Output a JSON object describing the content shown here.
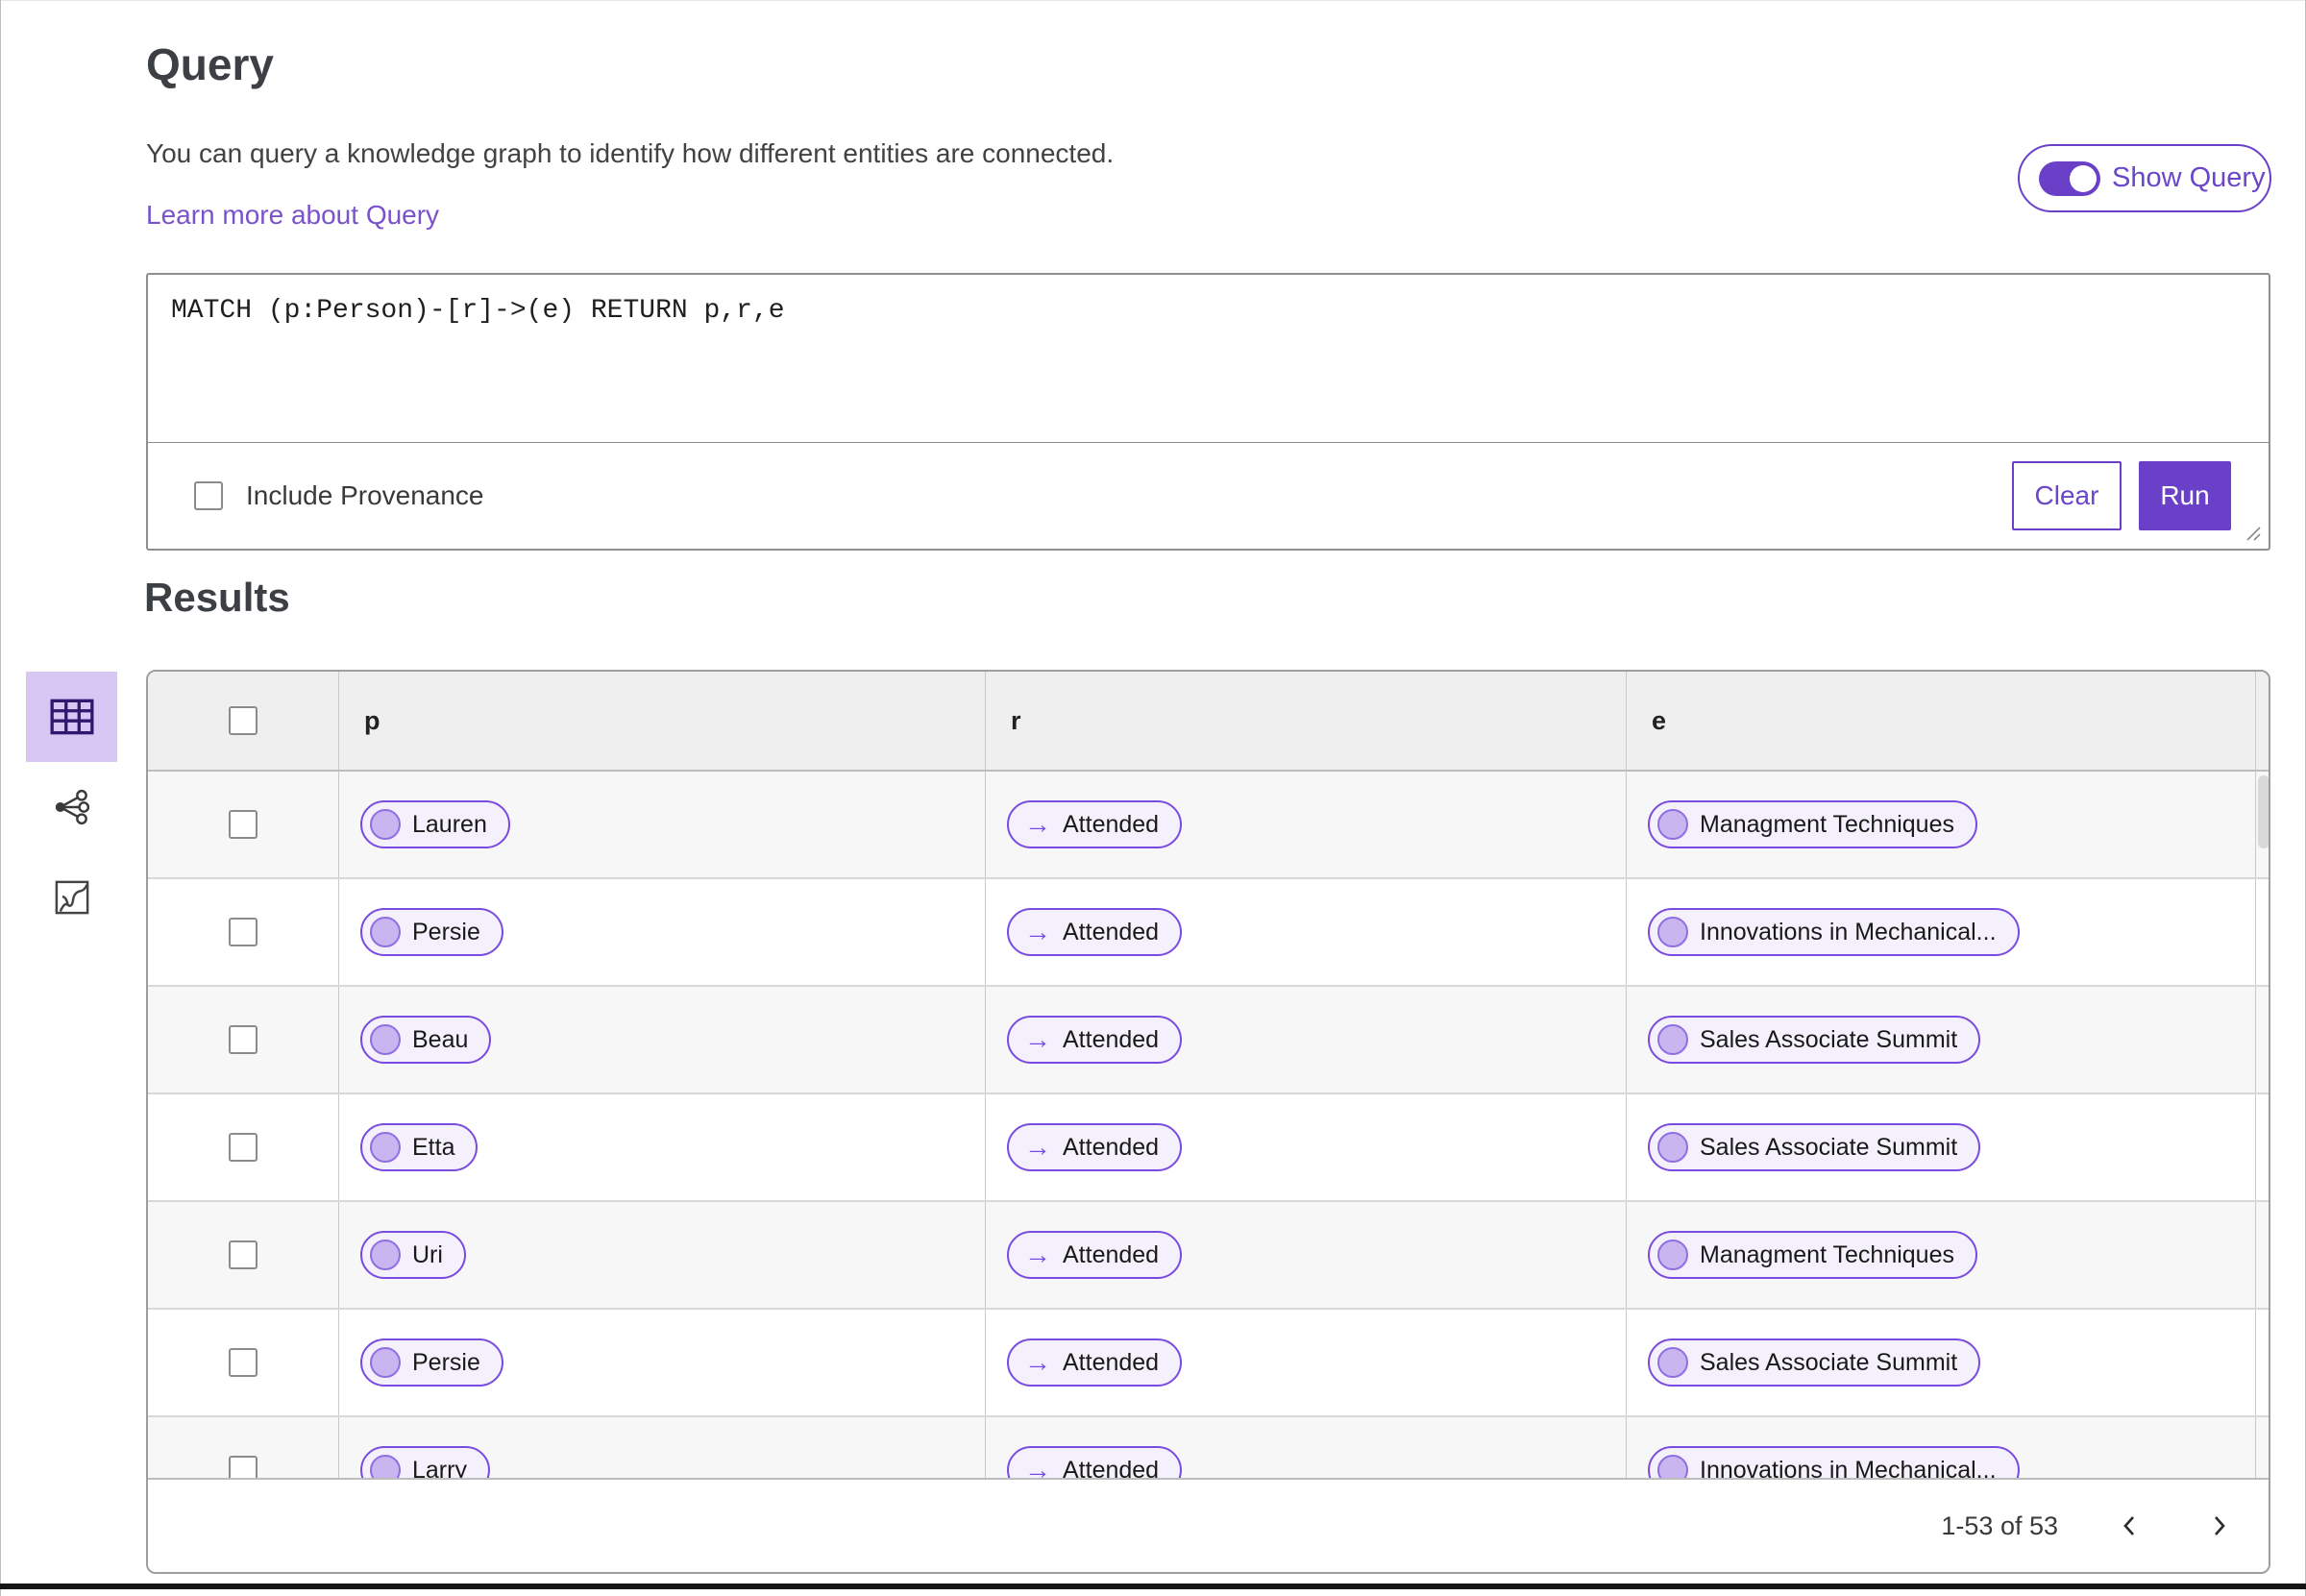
{
  "header": {
    "title": "Query",
    "description": "You can query a knowledge graph to identify how different entities are connected.",
    "learn_more": "Learn more about Query",
    "show_query_label": "Show Query",
    "show_query_on": true
  },
  "query": {
    "text": "MATCH (p:Person)-[r]->(e) RETURN p,r,e",
    "include_provenance_label": "Include Provenance",
    "include_provenance_checked": false,
    "clear_label": "Clear",
    "run_label": "Run"
  },
  "results": {
    "title": "Results",
    "views": [
      "table",
      "graph",
      "map"
    ],
    "selected_view": "table",
    "columns": [
      "p",
      "r",
      "e"
    ],
    "rows": [
      {
        "p": "Lauren",
        "r": "Attended",
        "e": "Managment Techniques"
      },
      {
        "p": "Persie",
        "r": "Attended",
        "e": "Innovations in Mechanical..."
      },
      {
        "p": "Beau",
        "r": "Attended",
        "e": "Sales Associate Summit"
      },
      {
        "p": "Etta",
        "r": "Attended",
        "e": "Sales Associate Summit"
      },
      {
        "p": "Uri",
        "r": "Attended",
        "e": "Managment Techniques"
      },
      {
        "p": "Persie",
        "r": "Attended",
        "e": "Sales Associate Summit"
      },
      {
        "p": "Larry",
        "r": "Attended",
        "e": "Innovations in Mechanical..."
      }
    ],
    "pagination": {
      "range_text": "1-53 of 53"
    }
  },
  "icons": {
    "arrow_right": "→"
  },
  "colors": {
    "accent_purple": "#6b40c9",
    "pill_border": "#7a4be0",
    "pill_background": "#f5f1fc",
    "pill_circle": "#c9b6f0",
    "link_purple": "#7a52cc",
    "selected_view_background": "#d8c7f5",
    "table_header_background": "#efefef",
    "row_alt_background": "#f7f7f7"
  }
}
